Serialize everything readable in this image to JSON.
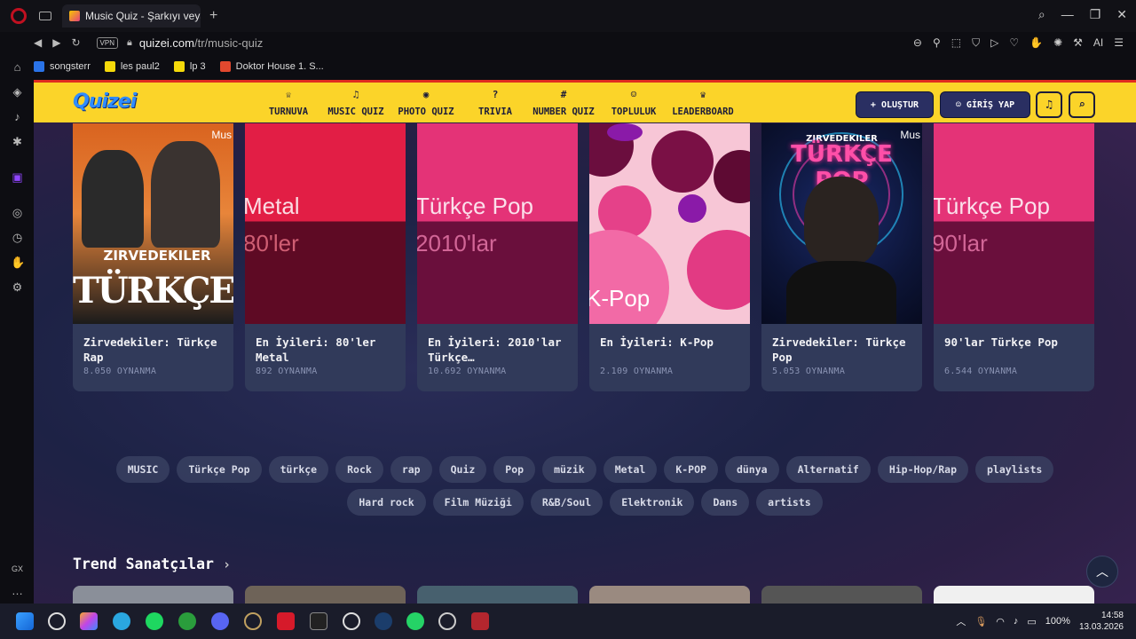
{
  "browser": {
    "tab_title": "Music Quiz - Şarkıyı veya s",
    "url_domain": "quizei.com",
    "url_path": "/tr/music-quiz",
    "vpn_label": "VPN",
    "ai_label": "AI",
    "bookmarks": [
      {
        "label": "songsterr",
        "color": "#2a73e8"
      },
      {
        "label": "les paul2",
        "color": "#f5d90a"
      },
      {
        "label": "lp 3",
        "color": "#f5d90a"
      },
      {
        "label": "Doktor House 1. S...",
        "color": "#e2482e"
      }
    ],
    "sidebar_label": "GX"
  },
  "site": {
    "logo": "Quizei",
    "nav": [
      {
        "label": "TURNUVA",
        "icon": "trophy-icon",
        "glyph": "♕"
      },
      {
        "label": "MUSIC QUIZ",
        "icon": "music-note-icon",
        "glyph": "♫"
      },
      {
        "label": "PHOTO QUIZ",
        "icon": "camera-icon",
        "glyph": "◉"
      },
      {
        "label": "TRIVIA",
        "icon": "question-icon",
        "glyph": "?"
      },
      {
        "label": "NUMBER QUIZ",
        "icon": "hash-icon",
        "glyph": "#"
      },
      {
        "label": "TOPLULUK",
        "icon": "users-icon",
        "glyph": "☺"
      },
      {
        "label": "LEADERBOARD",
        "icon": "crown-icon",
        "glyph": "♛"
      }
    ],
    "create_label": "OLUŞTUR",
    "login_label": "GİRİŞ YAP"
  },
  "cards": [
    {
      "title": "Zirvedekiler: Türkçe Rap",
      "plays": "8.050 OYNANMA",
      "art": "Zirvedekiler Türkçe Rap",
      "bg": "#d9631f"
    },
    {
      "title": "En İyileri: 80'ler Metal",
      "plays": "892 OYNANMA",
      "art": "Metal 80'ler",
      "bg": "#e21e45"
    },
    {
      "title": "En İyileri: 2010'lar Türkçe…",
      "plays": "10.692 OYNANMA",
      "art": "Türkçe Pop 2010'lar",
      "bg": "#e43377"
    },
    {
      "title": "En İyileri: K-Pop",
      "plays": "2.109 OYNANMA",
      "art": "K-Pop",
      "bg": "#f7c6d6"
    },
    {
      "title": "Zirvedekiler: Türkçe Pop",
      "plays": "5.053 OYNANMA",
      "art": "Zirvedekiler Türkçe Pop",
      "bg": "#0d1538"
    },
    {
      "title": "90'lar Türkçe Pop",
      "plays": "6.544 OYNANMA",
      "art": "Türkçe Pop 90'lar",
      "bg": "#e43377"
    }
  ],
  "apple_music_badge": "Mus",
  "tags_row1": [
    "MUSIC",
    "Türkçe Pop",
    "türkçe",
    "Rock",
    "rap",
    "Quiz",
    "Pop",
    "müzik",
    "Metal",
    "K-POP",
    "dünya",
    "Alternatif",
    "Hip-Hop/Rap",
    "playlists"
  ],
  "tags_row2": [
    "Hard rock",
    "Film Müziği",
    "R&B/Soul",
    "Elektronik",
    "Dans",
    "artists"
  ],
  "section_title": "Trend Sanatçılar",
  "taskbar": {
    "battery": "100%",
    "time": "14:58",
    "date": "13.03.2026"
  }
}
